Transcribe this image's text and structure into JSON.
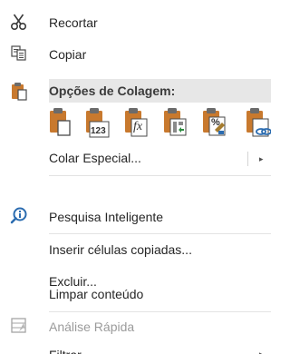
{
  "context_menu": {
    "recortar": {
      "label": "Recortar",
      "icon": "scissors-icon"
    },
    "copiar": {
      "label": "Copiar",
      "icon": "copy-icon"
    },
    "opcoes_colagem": {
      "label": "Opções de Colagem:",
      "icon": "paste-icon",
      "options": [
        {
          "name": "paste-option-keep",
          "icon": "paste-keep-icon"
        },
        {
          "name": "paste-option-values",
          "icon": "paste-values-icon",
          "badge": "123"
        },
        {
          "name": "paste-option-formulas",
          "icon": "paste-formulas-icon",
          "badge": "fx"
        },
        {
          "name": "paste-option-transpose",
          "icon": "paste-transpose-icon"
        },
        {
          "name": "paste-option-formatting",
          "icon": "paste-formatting-icon",
          "badge": "%"
        },
        {
          "name": "paste-option-link",
          "icon": "paste-link-icon"
        }
      ]
    },
    "colar_especial": {
      "label": "Colar Especial...",
      "arrow": "▸"
    },
    "pesquisa_inteligente": {
      "label": "Pesquisa Inteligente",
      "icon": "smart-lookup-icon"
    },
    "inserir_celulas": {
      "label": "Inserir células copiadas..."
    },
    "excluir": {
      "label": "Excluir..."
    },
    "limpar_conteudo": {
      "label": "Limpar conteúdo"
    },
    "analise_rapida": {
      "label": "Análise Rápida",
      "icon": "quick-analysis-icon",
      "disabled": true
    },
    "filtrar": {
      "label": "Filtrar",
      "arrow": "▸"
    }
  },
  "colors": {
    "accent_orange": "#c8792e",
    "accent_blue": "#2b6cb0",
    "header_bg": "#e7e7e7",
    "text": "#262626",
    "disabled_text": "#9b9b9b"
  }
}
